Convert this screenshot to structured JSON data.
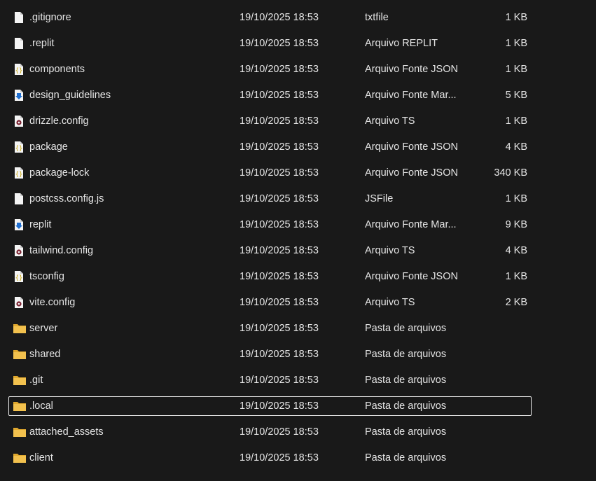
{
  "colors": {
    "background": "#191919",
    "text": "#e5e5e5",
    "folder": "#f2c14e",
    "selection_border": "#e6e6e6"
  },
  "rows": [
    {
      "name": ".gitignore",
      "date": "19/10/2025 18:53",
      "type": "txtfile",
      "size": "1 KB",
      "icon": "generic-file-icon"
    },
    {
      "name": ".replit",
      "date": "19/10/2025 18:53",
      "type": "Arquivo REPLIT",
      "size": "1 KB",
      "icon": "generic-file-icon"
    },
    {
      "name": "components",
      "date": "19/10/2025 18:53",
      "type": "Arquivo Fonte JSON",
      "size": "1 KB",
      "icon": "json-file-icon"
    },
    {
      "name": "design_guidelines",
      "date": "19/10/2025 18:53",
      "type": "Arquivo Fonte Mar...",
      "size": "5 KB",
      "icon": "markdown-file-icon"
    },
    {
      "name": "drizzle.config",
      "date": "19/10/2025 18:53",
      "type": "Arquivo TS",
      "size": "1 KB",
      "icon": "ts-file-icon"
    },
    {
      "name": "package",
      "date": "19/10/2025 18:53",
      "type": "Arquivo Fonte JSON",
      "size": "4 KB",
      "icon": "json-file-icon"
    },
    {
      "name": "package-lock",
      "date": "19/10/2025 18:53",
      "type": "Arquivo Fonte JSON",
      "size": "340 KB",
      "icon": "json-file-icon"
    },
    {
      "name": "postcss.config.js",
      "date": "19/10/2025 18:53",
      "type": "JSFile",
      "size": "1 KB",
      "icon": "generic-file-icon"
    },
    {
      "name": "replit",
      "date": "19/10/2025 18:53",
      "type": "Arquivo Fonte Mar...",
      "size": "9 KB",
      "icon": "markdown-file-icon"
    },
    {
      "name": "tailwind.config",
      "date": "19/10/2025 18:53",
      "type": "Arquivo TS",
      "size": "4 KB",
      "icon": "ts-file-icon"
    },
    {
      "name": "tsconfig",
      "date": "19/10/2025 18:53",
      "type": "Arquivo Fonte JSON",
      "size": "1 KB",
      "icon": "json-file-icon"
    },
    {
      "name": "vite.config",
      "date": "19/10/2025 18:53",
      "type": "Arquivo TS",
      "size": "2 KB",
      "icon": "ts-file-icon"
    },
    {
      "name": "server",
      "date": "19/10/2025 18:53",
      "type": "Pasta de arquivos",
      "size": "",
      "icon": "folder-icon"
    },
    {
      "name": "shared",
      "date": "19/10/2025 18:53",
      "type": "Pasta de arquivos",
      "size": "",
      "icon": "folder-icon"
    },
    {
      "name": ".git",
      "date": "19/10/2025 18:53",
      "type": "Pasta de arquivos",
      "size": "",
      "icon": "folder-icon"
    },
    {
      "name": ".local",
      "date": "19/10/2025 18:53",
      "type": "Pasta de arquivos",
      "size": "",
      "icon": "folder-icon",
      "selected": true
    },
    {
      "name": "attached_assets",
      "date": "19/10/2025 18:53",
      "type": "Pasta de arquivos",
      "size": "",
      "icon": "folder-icon"
    },
    {
      "name": "client",
      "date": "19/10/2025 18:53",
      "type": "Pasta de arquivos",
      "size": "",
      "icon": "folder-icon"
    }
  ]
}
